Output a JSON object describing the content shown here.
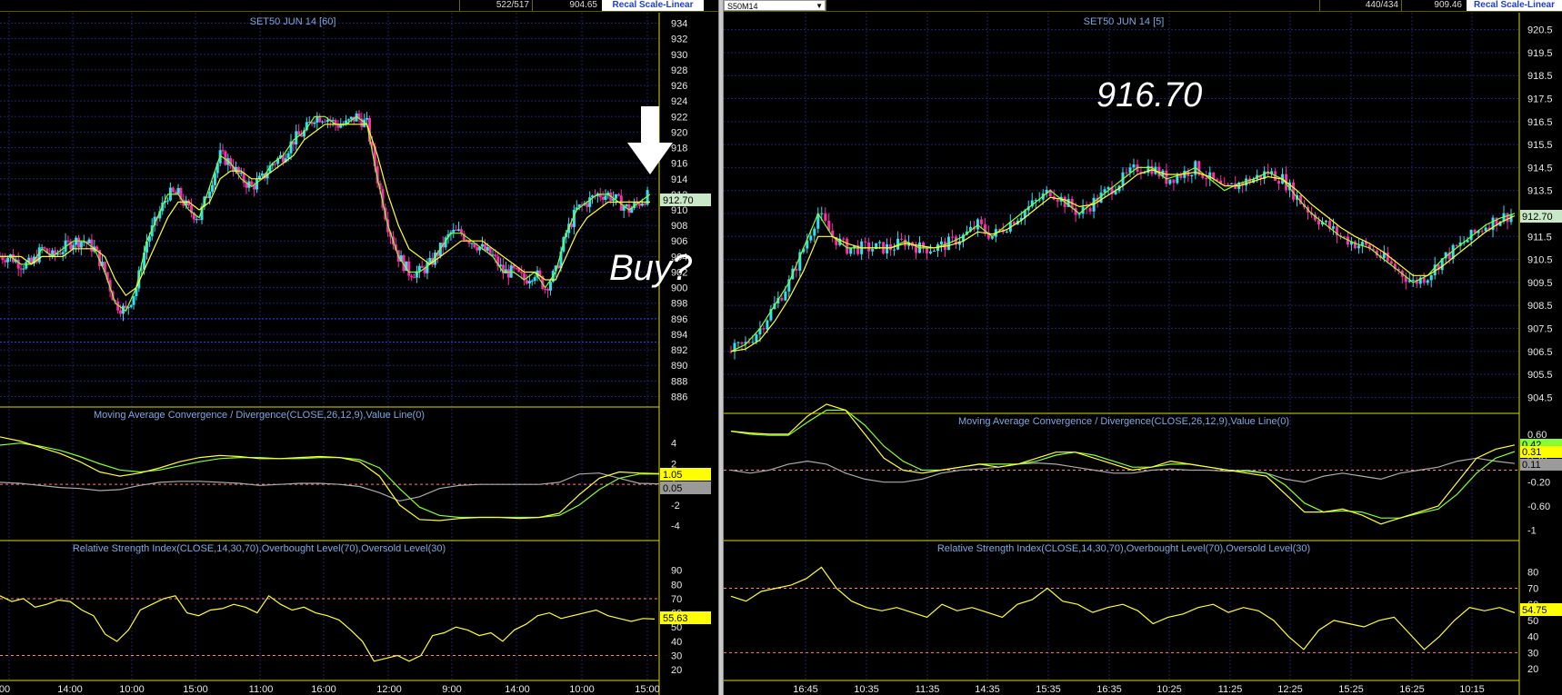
{
  "colors": {
    "background": "#000000",
    "grid": "#1f1f6e",
    "divider": "#d8d800",
    "axis_text": "#e8e8e8",
    "title_text": "#7fa8e0",
    "candle_up": "#33e0f0",
    "candle_down": "#ff2da8",
    "ma_fast": "#ffff33",
    "ma_slow": "#88ff33",
    "signal_line": "#aaaaaa",
    "ref_line": "#ff8080",
    "price_tag_bg": "#c8e8c8"
  },
  "left": {
    "topbar": {
      "bars": "522/517",
      "last": "904.65",
      "recal": "Recal Scale-Linear"
    },
    "price_panel": {
      "title": "SET50 JUN 14  [60]",
      "ticks": [
        "934",
        "932",
        "930",
        "928",
        "926",
        "924",
        "922",
        "920",
        "918",
        "916",
        "914",
        "912",
        "910",
        "908",
        "906",
        "904",
        "902",
        "900",
        "898",
        "896",
        "894",
        "892",
        "890",
        "888",
        "886"
      ],
      "last_tag": "912.70",
      "annotation": "Buy?",
      "arrow_icon": "down-arrow-icon"
    },
    "macd_panel": {
      "title": "Moving Average Convergence / Divergence(CLOSE,26,12,9),Value Line(0)",
      "ticks": [
        "4",
        "2",
        "0",
        "-2",
        "-4"
      ],
      "tag_macd": "1.05",
      "tag_hist": "0.05"
    },
    "rsi_panel": {
      "title": "Relative Strength Index(CLOSE,14,30,70),Overbought Level(70),Oversold Level(30)",
      "ticks": [
        "90",
        "80",
        "70",
        "60",
        "50",
        "40",
        "30",
        "20"
      ],
      "tag": "55.63"
    },
    "x_labels": [
      "00",
      "14:00",
      "10:00",
      "15:00",
      "11:00",
      "16:00",
      "12:00",
      "9:00",
      "14:00",
      "10:00",
      "15:00"
    ]
  },
  "right": {
    "topbar": {
      "symbol": "S50M14",
      "bars": "440/434",
      "last": "909.46",
      "recal": "Recal Scale-Linear"
    },
    "price_panel": {
      "title": "SET50 JUN 14  [5]",
      "ticks": [
        "920.5",
        "919.5",
        "918.5",
        "917.5",
        "916.5",
        "915.5",
        "914.5",
        "913.5",
        "912.5",
        "911.5",
        "910.5",
        "909.5",
        "908.5",
        "907.5",
        "906.5",
        "905.5",
        "904.5"
      ],
      "last_tag": "912.70",
      "annotation": "916.70"
    },
    "macd_panel": {
      "title": "Moving Average Convergence / Divergence(CLOSE,26,12,9),Value Line(0)",
      "ticks": [
        "0.60",
        "0.20",
        "-0.20",
        "-0.60",
        "-1"
      ],
      "tag_top": "0.42",
      "tag_macd": "0.31",
      "tag_hist": "0.11"
    },
    "rsi_panel": {
      "title": "Relative Strength Index(CLOSE,14,30,70),Overbought Level(70),Oversold Level(30)",
      "ticks": [
        "80",
        "70",
        "60",
        "50",
        "40",
        "30",
        "20"
      ],
      "tag": "54.75"
    },
    "x_labels": [
      "16:45",
      "10:35",
      "11:35",
      "14:35",
      "15:35",
      "16:35",
      "10:25",
      "11:25",
      "12:25",
      "15:25",
      "16:25",
      "10:15"
    ]
  },
  "chart_data": [
    {
      "type": "line",
      "title": "SET50 JUN 14  [60]",
      "panel": "price",
      "y_range": [
        885,
        935
      ],
      "series": [
        {
          "values": [
            904,
            904,
            903,
            903,
            905,
            904,
            905,
            906,
            906,
            905,
            902,
            898,
            897,
            900,
            906,
            909,
            912,
            912,
            910,
            909,
            913,
            917,
            916,
            914,
            913,
            914,
            916,
            917,
            919,
            920,
            922,
            922,
            921,
            921,
            922,
            921,
            914,
            908,
            904,
            902,
            902,
            903,
            905,
            907,
            907,
            906,
            905,
            904,
            902,
            902,
            901,
            902,
            900,
            902,
            907,
            910,
            911,
            912,
            912,
            911,
            910,
            911,
            912
          ]
        },
        {
          "values": [
            904,
            904,
            904,
            903,
            904,
            904,
            904,
            905,
            905,
            905,
            904,
            901,
            899,
            900,
            903,
            906,
            909,
            911,
            911,
            910,
            911,
            914,
            915,
            915,
            914,
            914,
            915,
            916,
            917,
            919,
            920,
            921,
            921,
            921,
            921,
            921,
            917,
            912,
            908,
            905,
            904,
            903,
            904,
            905,
            906,
            906,
            906,
            905,
            904,
            903,
            902,
            902,
            901,
            901,
            904,
            907,
            909,
            910,
            911,
            911,
            911,
            911,
            911
          ]
        }
      ],
      "last_value": 912.7
    },
    {
      "type": "line",
      "title": "Moving Average Convergence / Divergence(CLOSE,26,12,9),Value Line(0)",
      "panel": "macd-left",
      "y_range": [
        -5,
        6
      ],
      "series": [
        {
          "values": [
            4.6,
            4.2,
            3.6,
            3.0,
            2.2,
            1.2,
            0.8,
            1.1,
            1.6,
            2.2,
            2.6,
            2.8,
            2.7,
            2.5,
            2.5,
            2.6,
            2.7,
            2.6,
            2.2,
            0.8,
            -2.0,
            -3.4,
            -3.5,
            -3.3,
            -3.2,
            -3.2,
            -3.3,
            -3.2,
            -2.8,
            -1.0,
            0.6,
            1.2,
            1.1,
            1.05
          ]
        },
        {
          "values": [
            3.8,
            4.0,
            3.7,
            3.3,
            2.7,
            2.0,
            1.4,
            1.2,
            1.4,
            1.8,
            2.2,
            2.5,
            2.6,
            2.6,
            2.5,
            2.5,
            2.6,
            2.6,
            2.4,
            1.6,
            -0.4,
            -2.2,
            -3.0,
            -3.2,
            -3.2,
            -3.2,
            -3.2,
            -3.2,
            -3.0,
            -2.0,
            -0.5,
            0.6,
            1.0,
            1.0
          ]
        },
        {
          "values": [
            0.2,
            0.1,
            -0.1,
            -0.3,
            -0.4,
            -0.6,
            -0.5,
            -0.1,
            0.2,
            0.3,
            0.3,
            0.2,
            0.1,
            -0.1,
            0,
            0.1,
            0.1,
            0,
            -0.2,
            -0.8,
            -1.6,
            -1.2,
            -0.4,
            -0.1,
            0,
            0,
            0,
            0,
            0.2,
            1.0,
            1.1,
            0.6,
            0.1,
            0.05
          ]
        }
      ]
    },
    {
      "type": "line",
      "title": "Relative Strength Index(CLOSE,14,30,70),Overbought Level(70),Oversold Level(30)",
      "panel": "rsi-left",
      "y_range": [
        15,
        100
      ],
      "series": [
        {
          "values": [
            72,
            68,
            70,
            64,
            66,
            69,
            68,
            62,
            58,
            45,
            40,
            48,
            62,
            66,
            70,
            72,
            60,
            58,
            62,
            63,
            66,
            64,
            60,
            72,
            66,
            62,
            64,
            60,
            58,
            55,
            48,
            40,
            26,
            28,
            30,
            26,
            30,
            44,
            46,
            50,
            48,
            44,
            46,
            40,
            48,
            52,
            58,
            60,
            56,
            58,
            60,
            62,
            58,
            56,
            54,
            56,
            55.63
          ]
        }
      ]
    },
    {
      "type": "line",
      "title": "SET50 JUN 14  [5]",
      "panel": "price",
      "y_range": [
        904,
        921
      ],
      "series": [
        {
          "values": [
            906.5,
            906.8,
            907.5,
            908.5,
            909.5,
            911,
            912.5,
            911.5,
            911,
            911,
            911,
            911,
            911.3,
            911,
            911,
            911.2,
            911.5,
            912,
            911.5,
            912,
            912.5,
            913,
            913.5,
            913,
            912.5,
            913,
            913.5,
            914,
            914.5,
            914.5,
            914,
            914.2,
            914.5,
            914,
            913.5,
            913.8,
            914,
            914.3,
            914,
            913.2,
            912.5,
            912,
            911.5,
            911.2,
            911,
            910.5,
            910,
            909.5,
            909.8,
            910.5,
            911,
            911.5,
            912,
            912.3,
            912.5
          ]
        },
        {
          "values": [
            906.5,
            906.6,
            907,
            907.8,
            908.8,
            910,
            911.5,
            911.5,
            911.2,
            911,
            911,
            911,
            911.2,
            911.1,
            911,
            911.1,
            911.3,
            911.7,
            911.6,
            911.8,
            912.2,
            912.7,
            913.2,
            913.1,
            912.8,
            912.9,
            913.3,
            913.7,
            914.2,
            914.4,
            914.2,
            914.2,
            914.3,
            914.1,
            913.7,
            913.7,
            913.9,
            914.1,
            914,
            913.5,
            912.9,
            912.4,
            911.9,
            911.5,
            911.2,
            910.8,
            910.3,
            909.8,
            909.8,
            910.2,
            910.7,
            911.2,
            911.7,
            912.1,
            912.4
          ]
        }
      ],
      "last_value": 912.7
    },
    {
      "type": "line",
      "title": "Moving Average Convergence / Divergence(CLOSE,26,12,9),Value Line(0)",
      "panel": "macd-right",
      "y_range": [
        -1.1,
        0.72
      ],
      "series": [
        {
          "values": [
            0.65,
            0.62,
            0.6,
            0.6,
            0.9,
            1.1,
            1.0,
            0.6,
            0.2,
            0.0,
            -0.05,
            0.0,
            0.05,
            0.1,
            0.05,
            0.1,
            0.2,
            0.3,
            0.3,
            0.2,
            0.1,
            0.0,
            0.05,
            0.15,
            0.1,
            0.05,
            0.0,
            -0.05,
            -0.1,
            -0.4,
            -0.7,
            -0.7,
            -0.65,
            -0.75,
            -0.9,
            -0.8,
            -0.7,
            -0.6,
            -0.2,
            0.2,
            0.35,
            0.42
          ]
        },
        {
          "values": [
            0.65,
            0.6,
            0.58,
            0.58,
            0.8,
            1.0,
            1.0,
            0.75,
            0.4,
            0.15,
            0.0,
            0.0,
            0.05,
            0.1,
            0.1,
            0.1,
            0.15,
            0.25,
            0.3,
            0.25,
            0.15,
            0.05,
            0.05,
            0.1,
            0.1,
            0.05,
            0.0,
            -0.02,
            -0.05,
            -0.25,
            -0.55,
            -0.7,
            -0.68,
            -0.7,
            -0.8,
            -0.8,
            -0.72,
            -0.65,
            -0.4,
            -0.05,
            0.2,
            0.31
          ]
        },
        {
          "values": [
            0.0,
            -0.05,
            0.0,
            0.1,
            0.15,
            0.1,
            -0.05,
            -0.15,
            -0.2,
            -0.2,
            -0.15,
            -0.05,
            0.0,
            0.02,
            0.05,
            0.1,
            0.12,
            0.1,
            0.05,
            0.0,
            -0.05,
            -0.05,
            0.0,
            0.02,
            0.0,
            0.0,
            -0.02,
            0.0,
            -0.05,
            -0.15,
            -0.2,
            -0.1,
            -0.05,
            -0.1,
            -0.15,
            -0.05,
            0.0,
            0.05,
            0.15,
            0.2,
            0.15,
            0.11
          ]
        }
      ]
    },
    {
      "type": "line",
      "title": "Relative Strength Index(CLOSE,14,30,70),Overbought Level(70),Oversold Level(30)",
      "panel": "rsi-right",
      "y_range": [
        15,
        90
      ],
      "series": [
        {
          "values": [
            65,
            62,
            68,
            70,
            72,
            76,
            83,
            70,
            62,
            58,
            56,
            58,
            55,
            52,
            60,
            56,
            58,
            55,
            52,
            60,
            63,
            70,
            62,
            60,
            55,
            58,
            60,
            56,
            48,
            52,
            54,
            58,
            60,
            55,
            58,
            56,
            50,
            40,
            32,
            44,
            50,
            48,
            46,
            50,
            52,
            42,
            32,
            40,
            50,
            58,
            56,
            58,
            54.75
          ]
        }
      ]
    }
  ]
}
